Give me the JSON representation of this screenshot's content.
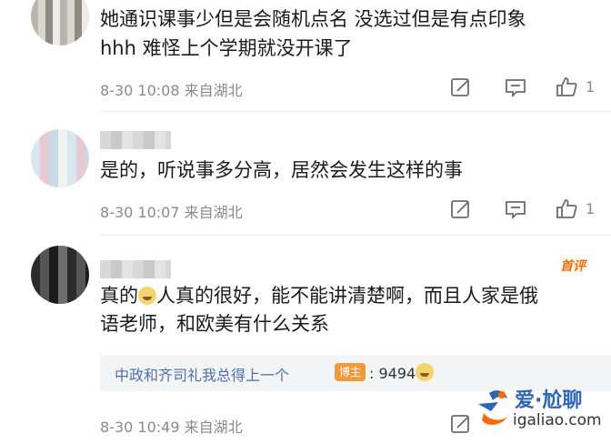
{
  "comments": [
    {
      "lines": [
        "她通识课事少但是会随机点名 没选过但是有点印象",
        "hhh 难怪上个学期就没开课了"
      ],
      "time": "8-30 10:08",
      "location": "来自湖北",
      "like_count": "1",
      "actions": [
        "share-icon",
        "reply-icon",
        "like-icon"
      ]
    },
    {
      "lines": [
        "是的，听说事多分高，居然会发生这样的事"
      ],
      "time": "8-30 10:07",
      "location": "来自湖北",
      "like_count": "1",
      "actions": [
        "share-icon",
        "reply-icon",
        "like-icon"
      ]
    },
    {
      "tag": "首评",
      "line1_a": "真的",
      "line1_b": "人真的很好，能不能讲清楚啊，而且人家是俄",
      "line2": "语老师，和欧美有什么关系",
      "time": "8-30 10:49",
      "location": "来自湖北",
      "reply": {
        "author": "中政和齐司礼我总得上一个",
        "badge": "博主",
        "text": "9494"
      },
      "emoji": "crying-face-icon",
      "actions": [
        "share-icon"
      ]
    }
  ],
  "watermark": {
    "title": "爱·尬聊",
    "site": "igaliao.com"
  },
  "colors": {
    "text": "#1a1a1a",
    "meta": "#8a8a8a",
    "link": "#4f6fa8",
    "badge": "#f29a3a",
    "hot_tag": "#ff6a00",
    "watermark_blue": "#2d66b2"
  }
}
